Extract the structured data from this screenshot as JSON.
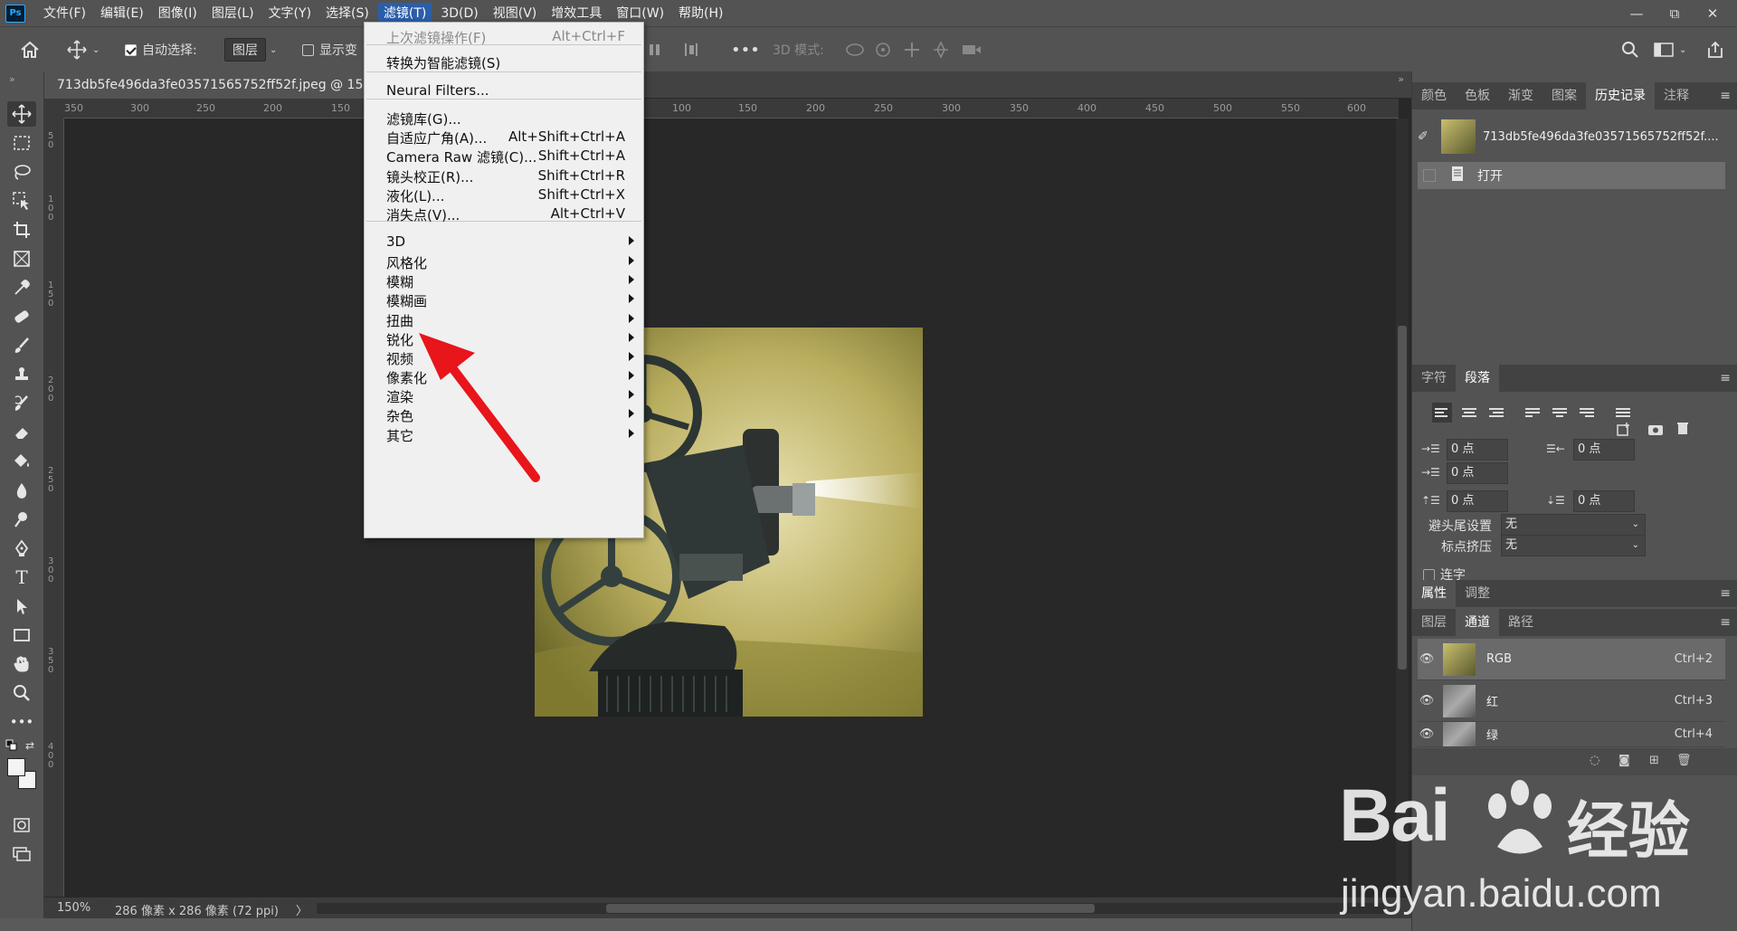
{
  "menubar": {
    "logo": "Ps",
    "items": [
      "文件(F)",
      "编辑(E)",
      "图像(I)",
      "图层(L)",
      "文字(Y)",
      "选择(S)",
      "滤镜(T)",
      "3D(D)",
      "视图(V)",
      "增效工具",
      "窗口(W)",
      "帮助(H)"
    ],
    "active_index": 6,
    "window_controls": [
      "—",
      "⧉",
      "✕"
    ]
  },
  "options_bar": {
    "auto_select_label": "自动选择:",
    "auto_select_checked": true,
    "auto_select_value": "图层",
    "show_transform_label": "显示变",
    "mode_3d_label": "3D 模式:"
  },
  "document": {
    "tab_title": "713db5fe496da3fe03571565752ff52f.jpeg @ 150%(",
    "ruler_h": [
      "350",
      "300",
      "250",
      "200",
      "150",
      "100",
      "150",
      "200",
      "250",
      "300",
      "350",
      "400",
      "450",
      "500",
      "550",
      "600"
    ],
    "ruler_v": [
      "5\n0",
      "1\n0\n0",
      "1\n5\n0",
      "2\n0\n0",
      "2\n5\n0",
      "3\n0\n0",
      "3\n5\n0",
      "4\n0\n0"
    ]
  },
  "status": {
    "zoom": "150%",
    "size": "286 像素 x 286 像素 (72 ppi)",
    "arrow": "〉"
  },
  "filter_menu": {
    "items": [
      {
        "label": "上次滤镜操作(F)",
        "shortcut": "Alt+Ctrl+F",
        "disabled": true
      },
      {
        "label": "转换为智能滤镜(S)",
        "shortcut": ""
      },
      {
        "label": "Neural Filters...",
        "shortcut": ""
      },
      {
        "label": "滤镜库(G)...",
        "shortcut": ""
      },
      {
        "label": "自适应广角(A)...",
        "shortcut": "Alt+Shift+Ctrl+A"
      },
      {
        "label": "Camera Raw 滤镜(C)...",
        "shortcut": "Shift+Ctrl+A"
      },
      {
        "label": "镜头校正(R)...",
        "shortcut": "Shift+Ctrl+R"
      },
      {
        "label": "液化(L)...",
        "shortcut": "Shift+Ctrl+X"
      },
      {
        "label": "消失点(V)...",
        "shortcut": "Alt+Ctrl+V"
      },
      {
        "label": "3D",
        "submenu": true
      },
      {
        "label": "风格化",
        "submenu": true
      },
      {
        "label": "模糊",
        "submenu": true
      },
      {
        "label": "模糊画",
        "submenu": true
      },
      {
        "label": "扭曲",
        "submenu": true
      },
      {
        "label": "锐化",
        "submenu": true
      },
      {
        "label": "视频",
        "submenu": true
      },
      {
        "label": "像素化",
        "submenu": true
      },
      {
        "label": "渲染",
        "submenu": true
      },
      {
        "label": "杂色",
        "submenu": true
      },
      {
        "label": "其它",
        "submenu": true
      }
    ]
  },
  "history_panel": {
    "tabs": [
      "颜色",
      "色板",
      "渐变",
      "图案",
      "历史记录",
      "注释"
    ],
    "active_tab": 4,
    "snapshot_name": "713db5fe496da3fe03571565752ff52f....",
    "states": [
      "打开"
    ]
  },
  "paragraph_panel": {
    "tabs": [
      "字符",
      "段落"
    ],
    "active_tab": 1,
    "indent_left": "0 点",
    "indent_right": "0 点",
    "first_line": "0 点",
    "space_before": "0 点",
    "space_after": "0 点",
    "kinsoku_label": "避头尾设置",
    "kinsoku_value": "无",
    "mojikumi_label": "标点挤压",
    "mojikumi_value": "无",
    "hyphenate_label": "连字"
  },
  "properties_panel": {
    "tabs": [
      "属性",
      "调整"
    ],
    "active_tab": 0
  },
  "channels_panel": {
    "tabs": [
      "图层",
      "通道",
      "路径"
    ],
    "active_tab": 1,
    "channels": [
      {
        "name": "RGB",
        "shortcut": "Ctrl+2"
      },
      {
        "name": "红",
        "shortcut": "Ctrl+3"
      },
      {
        "name": "绿",
        "shortcut": "Ctrl+4"
      }
    ]
  },
  "watermark": {
    "brand": "Bai",
    "brand_cn": "经验",
    "url": "jingyan.baidu.com"
  },
  "colors": {
    "menu_highlight": "#2b5ea9",
    "arrow": "#e8151b"
  }
}
